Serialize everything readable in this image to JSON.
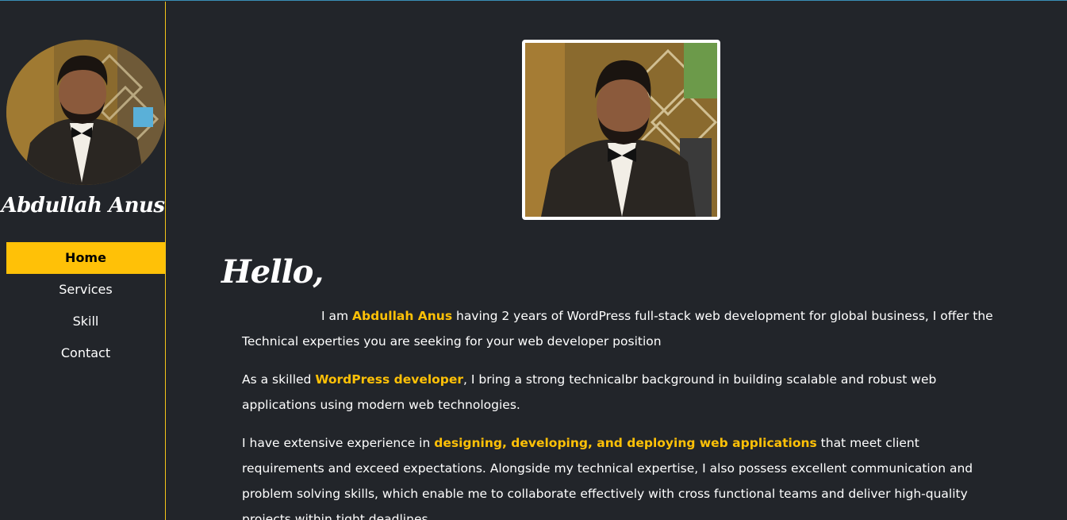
{
  "sidebar": {
    "name": "Abdullah Anus",
    "nav": [
      {
        "label": "Home",
        "active": true
      },
      {
        "label": "Services",
        "active": false
      },
      {
        "label": "Skill",
        "active": false
      },
      {
        "label": "Contact",
        "active": false
      }
    ]
  },
  "main": {
    "greeting": "Hello,",
    "p1": {
      "pre": "I am ",
      "hl": "Abdullah Anus",
      "post": " having 2 years of WordPress full-stack web development for global business, I offer the Technical experties you are seeking for your web developer position"
    },
    "p2": {
      "pre": "As a skilled ",
      "hl": "WordPress developer",
      "post": ", I bring a strong technicalbr background in building scalable and robust web applications using modern web technologies."
    },
    "p3": {
      "pre": "I have extensive experience in ",
      "hl": "designing, developing, and deploying web applications",
      "post": " that meet client requirements and exceed expectations. Alongside my technical expertise, I also possess excellent communication and problem solving skills, which enable me to collaborate effectively with cross functional teams and deliver high-quality projects within tight deadlines."
    }
  },
  "colors": {
    "background": "#22252a",
    "accent": "#ffc107",
    "sidebar_border": "#f5c518",
    "text": "#ffffff"
  }
}
